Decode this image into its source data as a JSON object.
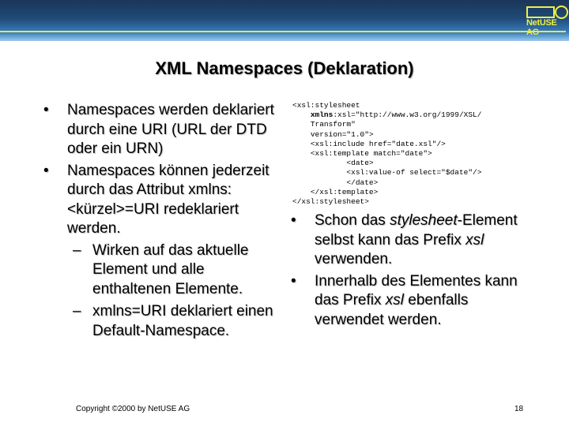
{
  "logo": {
    "text": "NetUSE AG"
  },
  "title": "XML Namespaces (Deklaration)",
  "left_bullets": [
    {
      "text": "Namespaces werden deklariert durch eine URI (URL der DTD oder ein URN)"
    },
    {
      "text": "Namespaces können jederzeit durch das Attribut xmlns:<kürzel>=URI redeklariert werden."
    }
  ],
  "left_sub": [
    {
      "text": "Wirken auf das aktuelle Element und alle enthaltenen Elemente."
    },
    {
      "text": "xmlns=URI deklariert einen Default-Namespace."
    }
  ],
  "markers": {
    "bullet": "•",
    "dash": "–"
  },
  "code": {
    "l1": "<xsl:stylesheet",
    "l2_bold": "xmlns",
    "l2_rest": ":xsl=\"http://www.w3.org/1999/XSL/",
    "l3": "Transform\"",
    "l4": "version=\"1.0\">",
    "l5": "<xsl:include href=\"date.xsl\"/>",
    "l6": "<xsl:template match=\"date\">",
    "l7": "<date>",
    "l8": "<xsl:value-of select=\"$date\"/>",
    "l9": "</date>",
    "l10": "</xsl:template>",
    "l11": "</xsl:stylesheet>"
  },
  "right_bullets": [
    {
      "a": "Schon das ",
      "i": "stylesheet",
      "b": "-Element selbst kann das Prefix ",
      "i2": "xsl",
      "c": " verwenden."
    },
    {
      "a": "Innerhalb des Elementes kann das Prefix ",
      "i": "xsl",
      "b": " ebenfalls verwendet werden."
    }
  ],
  "footer": {
    "copyright": "Copyright ©2000 by NetUSE AG",
    "page": "18"
  }
}
